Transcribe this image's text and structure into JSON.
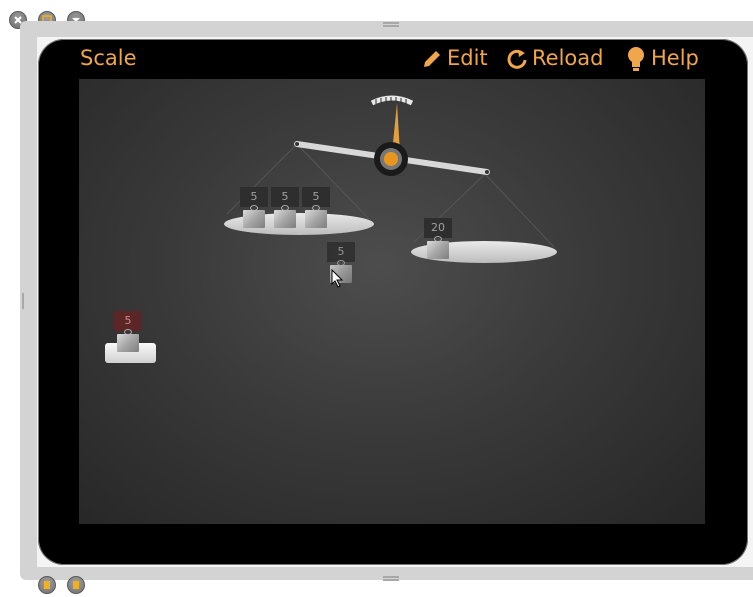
{
  "app": {
    "title": "Scale",
    "toolbar": {
      "edit_label": "Edit",
      "reload_label": "Reload",
      "help_label": "Help"
    }
  },
  "weights": {
    "left_pan": [
      "5",
      "5",
      "5"
    ],
    "dragging": "5",
    "right_pan": "20",
    "tray": "5"
  },
  "colors": {
    "accent": "#f0a64a",
    "pan_gold": "#e8961e",
    "screen_bg": "#3a3a3a",
    "device_bezel": "#000000"
  }
}
